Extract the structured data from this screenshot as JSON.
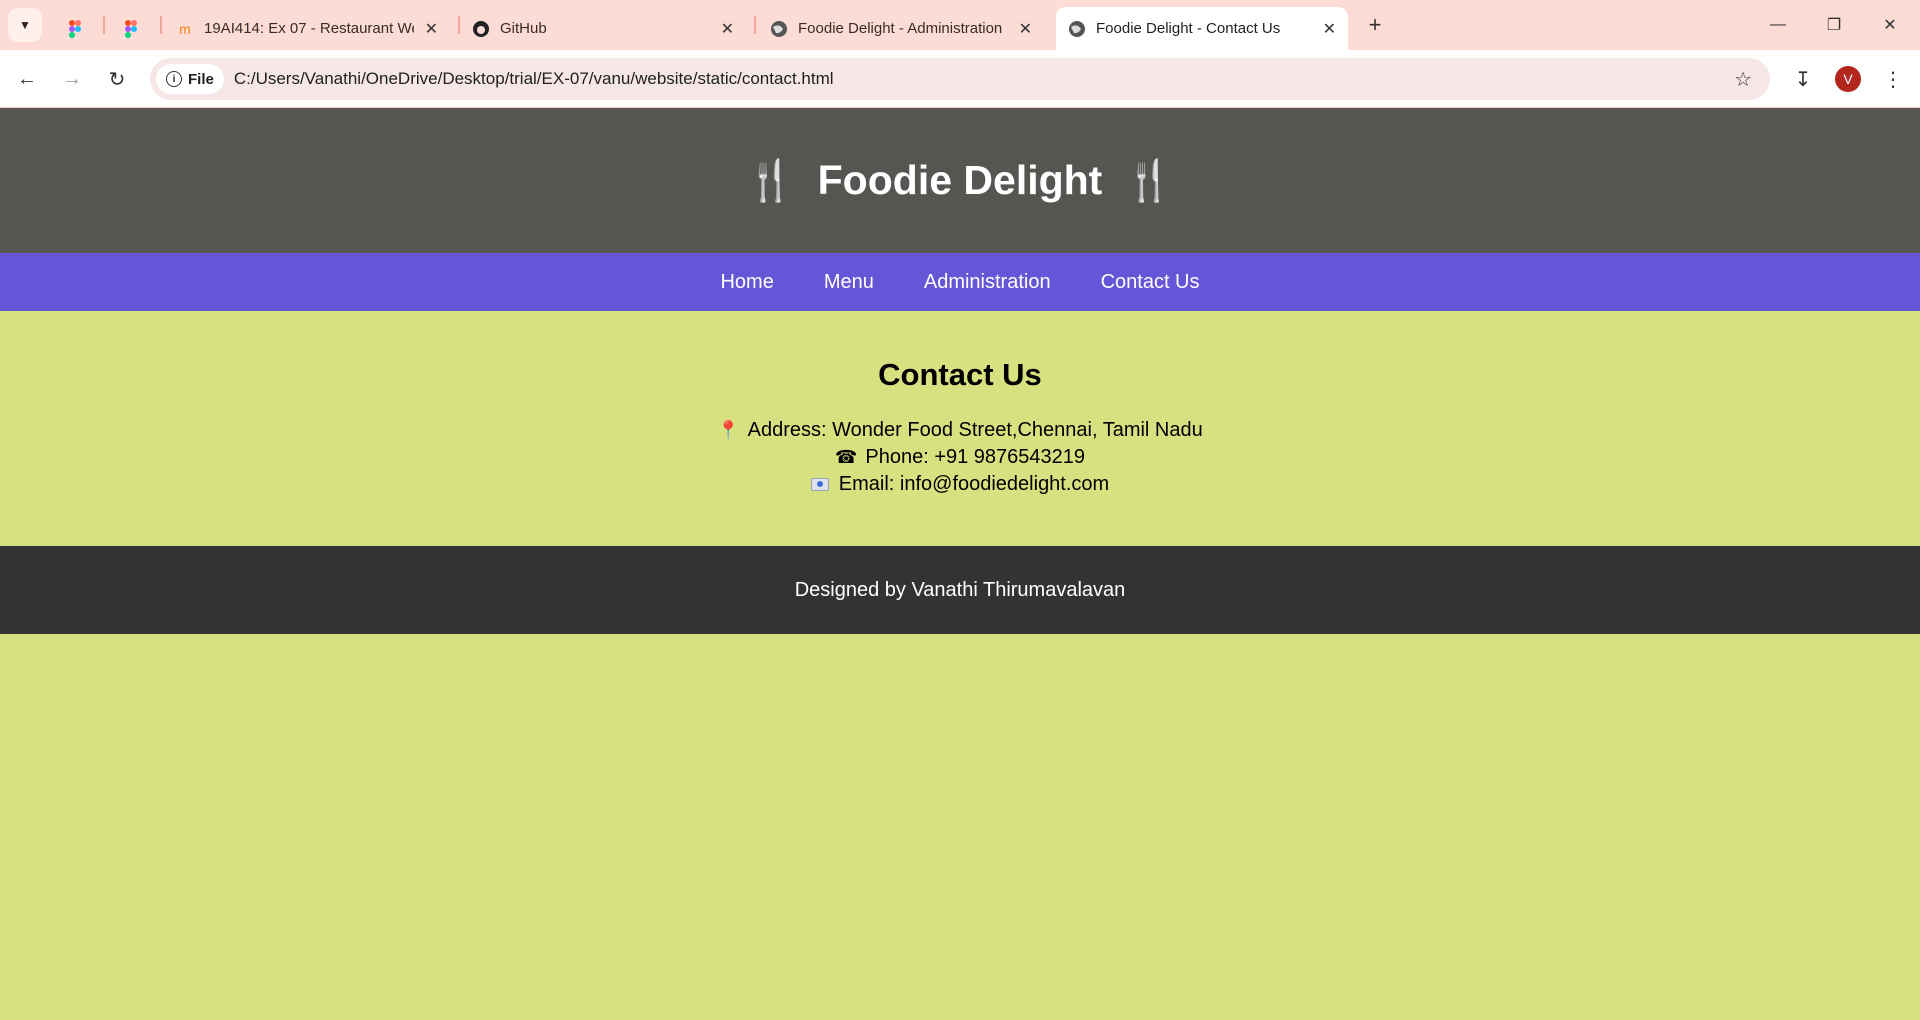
{
  "browser": {
    "tabs": [
      {
        "title": "",
        "favicon": "figma-icon"
      },
      {
        "title": "",
        "favicon": "figma-icon"
      },
      {
        "title": "19AI414: Ex 07 - Restaurant We",
        "favicon": "moodle-icon"
      },
      {
        "title": "GitHub",
        "favicon": "github-icon"
      },
      {
        "title": "Foodie Delight - Administration",
        "favicon": "globe-icon"
      },
      {
        "title": "Foodie Delight - Contact Us",
        "favicon": "globe-icon",
        "active": true
      }
    ],
    "address_chip": "File",
    "url": "C:/Users/Vanathi/OneDrive/Desktop/trial/EX-07/vanu/website/static/contact.html",
    "profile_initial": "V"
  },
  "site": {
    "title": "Foodie Delight",
    "nav": [
      "Home",
      "Menu",
      "Administration",
      "Contact Us"
    ],
    "contact": {
      "heading": "Contact Us",
      "address": "Address: Wonder Food Street,Chennai, Tamil Nadu",
      "phone": "Phone: +91 9876543219",
      "email": "Email: info@foodiedelight.com"
    },
    "footer": "Designed by Vanathi Thirumavalavan"
  },
  "colors": {
    "header_bg": "#555652",
    "nav_bg": "#6655d6",
    "body_bg": "#d8e17f",
    "footer_bg": "#333333",
    "tabstrip_bg": "#fcdcd4"
  }
}
